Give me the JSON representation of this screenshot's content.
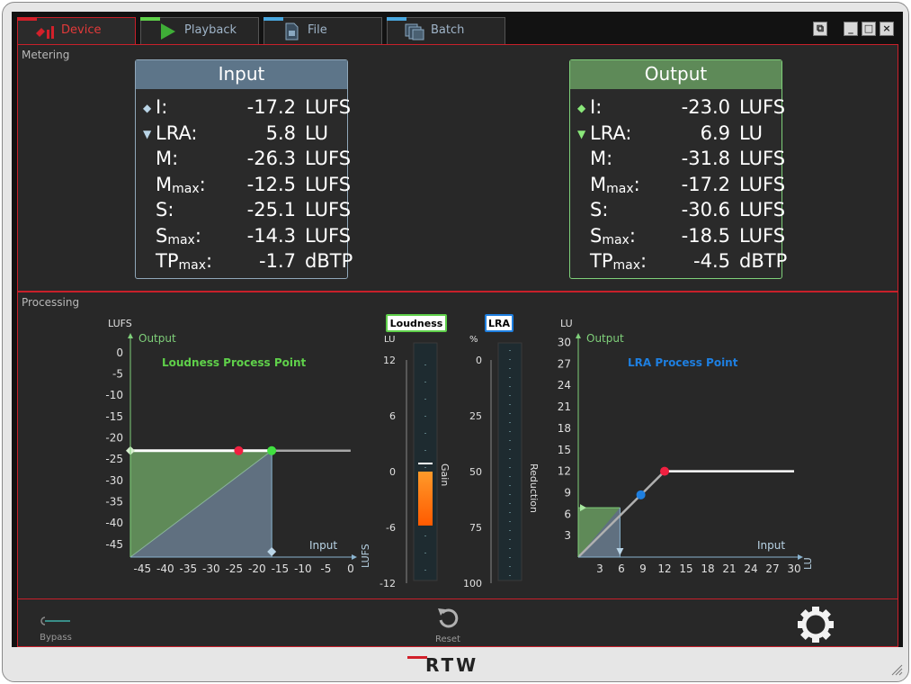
{
  "tabs": [
    {
      "label": "Device",
      "icon": "device-red-icon",
      "active": true
    },
    {
      "label": "Playback",
      "icon": "play-icon"
    },
    {
      "label": "File",
      "icon": "file-icon"
    },
    {
      "label": "Batch",
      "icon": "batch-icon"
    }
  ],
  "window": {
    "controls": [
      "detach",
      "minimize",
      "maximize",
      "close"
    ]
  },
  "metering": {
    "label": "Metering",
    "input": {
      "title": "Input",
      "rows": [
        {
          "key": "I:",
          "value": "-17.2",
          "unit": "LUFS",
          "marker": "◆"
        },
        {
          "key": "LRA:",
          "value": "5.8",
          "unit": "LU",
          "marker": "▼"
        },
        {
          "key": "M:",
          "value": "-26.3",
          "unit": "LUFS"
        },
        {
          "key": "M",
          "sub": "max",
          "colon": ":",
          "value": "-12.5",
          "unit": "LUFS"
        },
        {
          "key": "S:",
          "value": "-25.1",
          "unit": "LUFS"
        },
        {
          "key": "S",
          "sub": "max",
          "colon": ":",
          "value": "-14.3",
          "unit": "LUFS"
        },
        {
          "key": "TP",
          "sub": "max",
          "colon": ":",
          "value": "-1.7",
          "unit": "dBTP"
        }
      ]
    },
    "output": {
      "title": "Output",
      "rows": [
        {
          "key": "I:",
          "value": "-23.0",
          "unit": "LUFS",
          "marker": "◆"
        },
        {
          "key": "LRA:",
          "value": "6.9",
          "unit": "LU",
          "marker": "▼"
        },
        {
          "key": "M:",
          "value": "-31.8",
          "unit": "LUFS"
        },
        {
          "key": "M",
          "sub": "max",
          "colon": ":",
          "value": "-17.2",
          "unit": "LUFS"
        },
        {
          "key": "S:",
          "value": "-30.6",
          "unit": "LUFS"
        },
        {
          "key": "S",
          "sub": "max",
          "colon": ":",
          "value": "-18.5",
          "unit": "LUFS"
        },
        {
          "key": "TP",
          "sub": "max",
          "colon": ":",
          "value": "-4.5",
          "unit": "dBTP"
        }
      ]
    }
  },
  "processing": {
    "label": "Processing",
    "loudness_graph": {
      "title": "Loudness Process Point",
      "y_unit": "LUFS",
      "y_axis_label": "Output",
      "x_axis_label": "Input",
      "x_unit": "LUFS",
      "y_ticks": [
        "0",
        "-5",
        "-10",
        "-15",
        "-20",
        "-25",
        "-30",
        "-35",
        "-40",
        "-45"
      ],
      "x_ticks": [
        "-45",
        "-40",
        "-35",
        "-30",
        "-25",
        "-20",
        "-15",
        "-10",
        "-5",
        "0"
      ],
      "input_marker_x": -17.2,
      "output_marker_y": -23.0,
      "process_point_x": -17.2,
      "red_point_x": -24.4,
      "target_y": -23.0
    },
    "loudness_meter": {
      "badge": "Loudness",
      "unit": "LU",
      "side_label": "Gain",
      "ticks": [
        "12",
        "6",
        "0",
        "-6",
        "-12"
      ],
      "gain_value": -5.8
    },
    "lra_meter": {
      "badge": "LRA",
      "unit": "%",
      "side_label": "Reduction",
      "ticks": [
        "0",
        "25",
        "50",
        "75",
        "100"
      ],
      "reduction_value": 0
    },
    "lra_graph": {
      "title": "LRA Process Point",
      "y_unit": "LU",
      "y_axis_label": "Output",
      "x_axis_label": "Input",
      "x_unit": "LU",
      "y_ticks": [
        "30",
        "27",
        "24",
        "21",
        "18",
        "15",
        "12",
        "9",
        "6",
        "3"
      ],
      "x_ticks": [
        "3",
        "6",
        "9",
        "12",
        "15",
        "18",
        "21",
        "24",
        "27",
        "30"
      ],
      "input_marker_x": 5.8,
      "output_marker_y": 6.9,
      "process_point_x": 8.7,
      "red_point_x": 12
    }
  },
  "footer": {
    "bypass_label": "Bypass",
    "reset_label": "Reset",
    "settings_icon": "gear-icon"
  },
  "brand": "RTW",
  "colors": {
    "accent_red": "#d2202a",
    "green": "#5fd04a",
    "blue": "#1e7fe0",
    "orange": "#ff6a00"
  }
}
